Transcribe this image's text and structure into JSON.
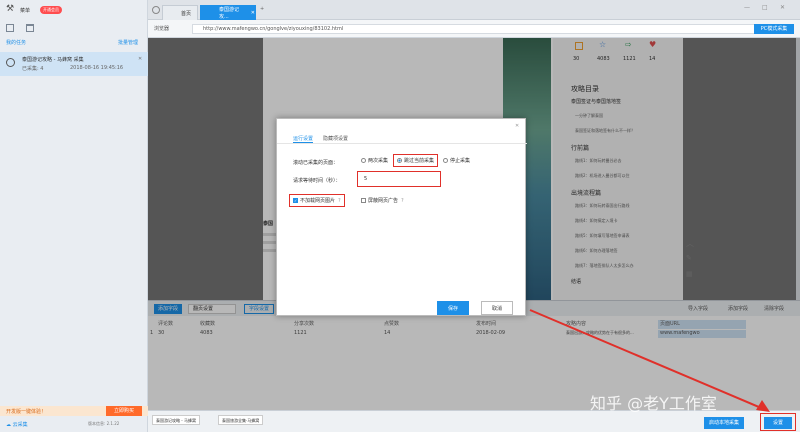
{
  "app": {
    "menu_label": "菜单",
    "badge": "开通会员",
    "tasks_title": "我的任务",
    "tasks_manage": "批量管理",
    "task": {
      "name": "泰国游记攻略 - 马蜂窝 采集",
      "progress": "已采集: 4",
      "date": "2018-08-16 19:45:16"
    },
    "trial_notice": "开发版一键体验！",
    "trial_btn": "立即购买",
    "cloud": "云采集",
    "window_controls": [
      "—",
      "□",
      "✕"
    ]
  },
  "browser": {
    "tabs": [
      {
        "label": "首页"
      },
      {
        "label": "泰国游记攻..."
      }
    ],
    "mode": "浏览器",
    "url": "http://www.mafengwo.cn/gonglve/ziyouxing/83102.html",
    "top_btn": "PC模式采集"
  },
  "webpage": {
    "stats": [
      "30",
      "4083",
      "1121",
      "14"
    ],
    "toc_title": "攻略目录",
    "toc": [
      "泰国签证与泰国落地签",
      "一分钟了解泰国",
      "泰国签证和落地签有什么不一样？",
      "行前篇",
      "路线1：如何玩转曼谷必去",
      "路线2：机场进入曼谷都可以住",
      "出境流程篇",
      "路线3：如何玩转泰国出行路线",
      "路线4：如何搞定入境卡",
      "路线5：如何填写落地签申请表",
      "路线6：如何办理落地签",
      "路线7：落地签排队人太多怎么办",
      "结语"
    ],
    "side_labels": [
      "泰国",
      "国庆"
    ],
    "article_heading": "泰国"
  },
  "dialog": {
    "tabs": [
      "运行设置",
      "隐藏项设置"
    ],
    "load_label": "滚动已采集的页面：",
    "radio_options": [
      "两次采集",
      "跳过当前采集",
      "停止采集"
    ],
    "delay_label": "请求等待时间（秒）：",
    "delay_value": "5",
    "check_options": [
      "不加载网页图片",
      "屏蔽网页广告"
    ],
    "save_btn": "保存",
    "cancel_btn": "取消"
  },
  "table": {
    "toolbar": {
      "add_field": "添加字段",
      "select": "翻页设置",
      "filter": "字段设置",
      "import": "导入字段",
      "export": "添加字段",
      "clear": "清除字段"
    },
    "headers": [
      "评论数",
      "收藏数",
      "分享次数",
      "点赞数",
      "发布时间",
      "攻略内容",
      "页面URL"
    ],
    "rows": [
      [
        "30",
        "4083",
        "1121",
        "14",
        "2018-02-09",
        "泰国出游，攻略的优势在于有很多的...",
        "www.mafengwo"
      ]
    ]
  },
  "status": {
    "tabs": [
      "泰国游记攻略 - 马蜂窝",
      "泰国旅游全集·马蜂窝"
    ],
    "version": "版本信息: 2.1.22",
    "start_btn": "启动本地采集",
    "settings_btn": "设置"
  },
  "watermark": "知乎 @老Y工作室",
  "colors": {
    "accent": "#1e90e8",
    "highlight": "#e0302a",
    "badge": "#ff4d4f"
  }
}
